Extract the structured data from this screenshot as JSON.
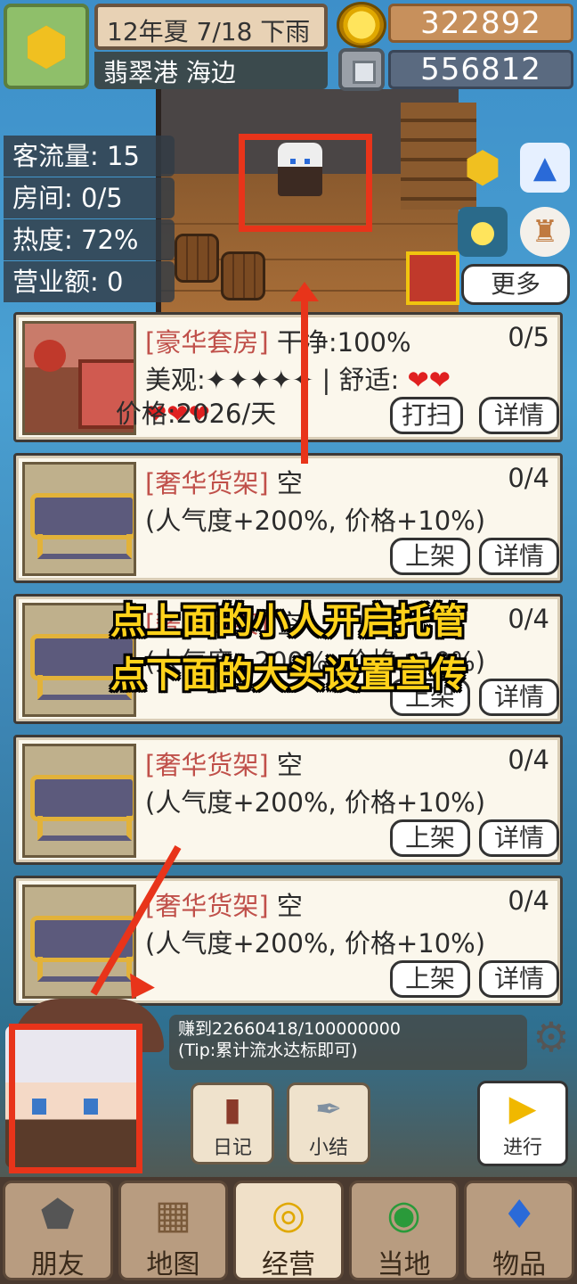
{
  "top": {
    "date": "12年夏 7/18 下雨",
    "location": "翡翠港 海边",
    "coins": "322892",
    "gems": "556812"
  },
  "stats": {
    "traffic": "客流量: 15",
    "rooms": "房间: 0/5",
    "heat": "热度: 72%",
    "revenue": "营业额: 0"
  },
  "more_label": "更多",
  "cards": [
    {
      "tag": "[豪华套房]",
      "status": "干净:100%",
      "count": "0/5",
      "line2_a": "美观:✦✦✦✦✦ | 舒适: ",
      "hearts_a": "❤❤",
      "hearts_b": "❤❤❤",
      "line3": "价格:2026/天",
      "btn1": "打扫",
      "btn2": "详情"
    },
    {
      "tag": "[奢华货架]",
      "status": "空",
      "count": "0/4",
      "line2": "(人气度+200%, 价格+10%)",
      "btn1": "上架",
      "btn2": "详情"
    },
    {
      "tag": "[奢华货架]",
      "status": "空",
      "count": "0/4",
      "line2": "(人气度+200%, 价格+10%)",
      "btn1": "上架",
      "btn2": "详情"
    },
    {
      "tag": "[奢华货架]",
      "status": "空",
      "count": "0/4",
      "line2": "(人气度+200%, 价格+10%)",
      "btn1": "上架",
      "btn2": "详情"
    },
    {
      "tag": "[奢华货架]",
      "status": "空",
      "count": "0/4",
      "line2": "(人气度+200%, 价格+10%)",
      "btn1": "上架",
      "btn2": "详情"
    }
  ],
  "overlay": {
    "line1": "点上面的小人开启托管",
    "line2": "点下面的大头设置宣传"
  },
  "progress": {
    "earned": "赚到22660418/100000000",
    "tip": "(Tip:累计流水达标即可)"
  },
  "mini": {
    "diary": "日记",
    "summary": "小结",
    "proceed": "进行"
  },
  "nav": [
    "朋友",
    "地图",
    "经营",
    "当地",
    "物品"
  ],
  "colors": {
    "annotation_red": "#e8341a",
    "overlay_yellow": "#ffd21a",
    "tag_red": "#c0504a"
  }
}
